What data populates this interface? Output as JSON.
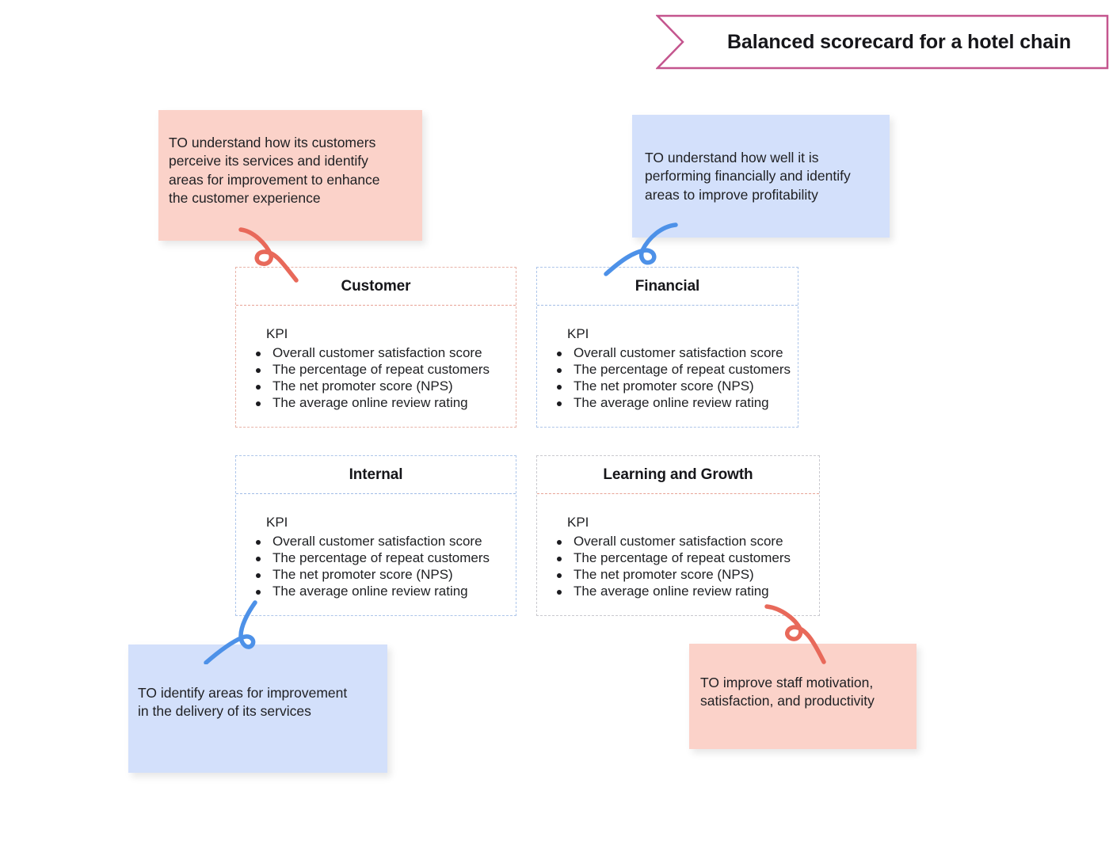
{
  "banner": {
    "title": "Balanced scorecard for a hotel chain",
    "border_color": "#c4558e",
    "fill_color": "#ffffff"
  },
  "colors": {
    "sticky_pink": "#fbd2c9",
    "sticky_blue": "#d3e0fb",
    "arrow_red": "#e8695a",
    "arrow_blue": "#4d91e8",
    "card_border_red": "#e8b3a8",
    "card_border_blue": "#aec6ea",
    "card_border_gray": "#c9c9cf",
    "text": "#202124"
  },
  "notes": {
    "customer": {
      "text": "TO understand how its customers\nperceive its services and identify\nareas for improvement to enhance\nthe customer experience",
      "color": "#fbd2c9"
    },
    "financial": {
      "text": "TO understand how well it is\nperforming financially and identify\nareas to improve profitability",
      "color": "#d3e0fb"
    },
    "internal": {
      "text": "TO identify areas for improvement\nin the delivery of its services",
      "color": "#d3e0fb"
    },
    "learning": {
      "text": "TO improve staff motivation,\nsatisfaction, and productivity",
      "color": "#fbd2c9"
    }
  },
  "cards": {
    "customer": {
      "title": "Customer",
      "kpi_label": "KPI",
      "kpis": [
        "Overall customer satisfaction score",
        "The percentage of repeat customers",
        "The net promoter score (NPS)",
        "The average online review rating"
      ]
    },
    "financial": {
      "title": "Financial",
      "kpi_label": "KPI",
      "kpis": [
        "Overall customer satisfaction score",
        "The percentage of repeat customers",
        "The net promoter score (NPS)",
        "The average online review rating"
      ]
    },
    "internal": {
      "title": "Internal",
      "kpi_label": "KPI",
      "kpis": [
        "Overall customer satisfaction score",
        "The percentage of repeat customers",
        "The net promoter score (NPS)",
        "The average online review rating"
      ]
    },
    "learning": {
      "title": "Learning and Growth",
      "kpi_label": "KPI",
      "kpis": [
        "Overall customer satisfaction score",
        "The percentage of repeat customers",
        "The net promoter score (NPS)",
        "The average online review rating"
      ]
    }
  }
}
